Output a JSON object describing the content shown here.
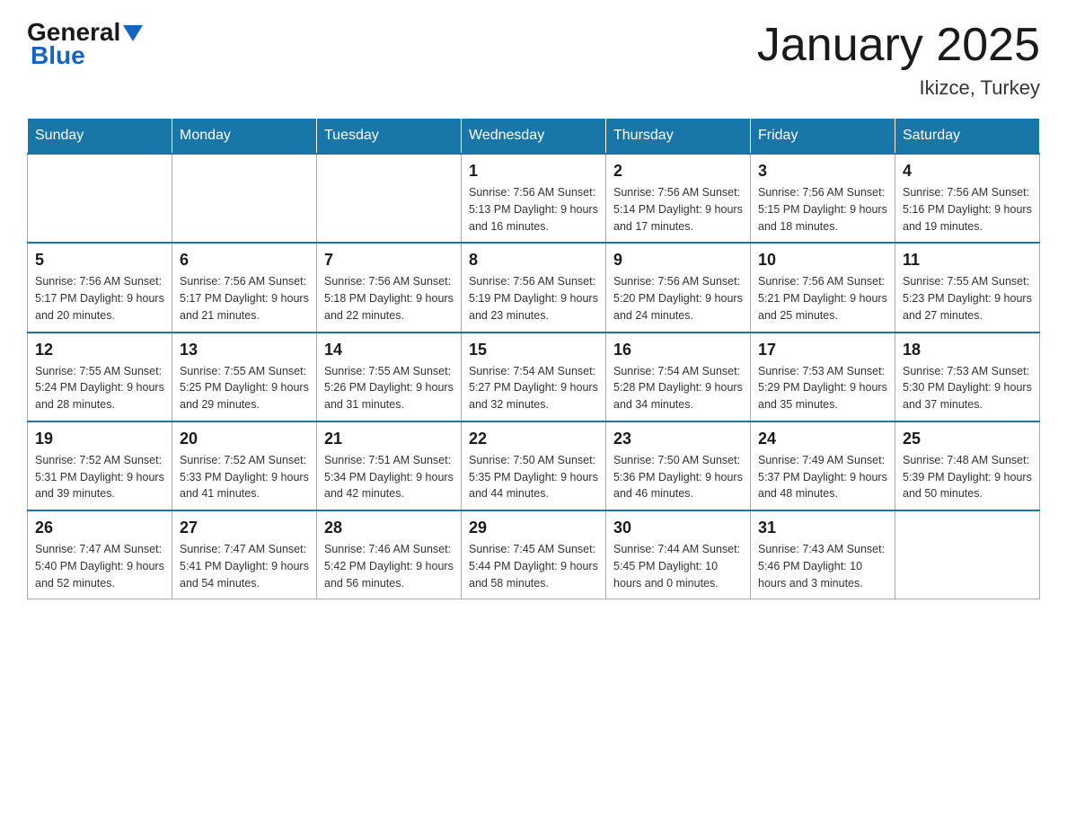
{
  "header": {
    "logo_general": "General",
    "logo_blue": "Blue",
    "title": "January 2025",
    "subtitle": "Ikizce, Turkey"
  },
  "days_of_week": [
    "Sunday",
    "Monday",
    "Tuesday",
    "Wednesday",
    "Thursday",
    "Friday",
    "Saturday"
  ],
  "weeks": [
    [
      {
        "day": "",
        "info": ""
      },
      {
        "day": "",
        "info": ""
      },
      {
        "day": "",
        "info": ""
      },
      {
        "day": "1",
        "info": "Sunrise: 7:56 AM\nSunset: 5:13 PM\nDaylight: 9 hours\nand 16 minutes."
      },
      {
        "day": "2",
        "info": "Sunrise: 7:56 AM\nSunset: 5:14 PM\nDaylight: 9 hours\nand 17 minutes."
      },
      {
        "day": "3",
        "info": "Sunrise: 7:56 AM\nSunset: 5:15 PM\nDaylight: 9 hours\nand 18 minutes."
      },
      {
        "day": "4",
        "info": "Sunrise: 7:56 AM\nSunset: 5:16 PM\nDaylight: 9 hours\nand 19 minutes."
      }
    ],
    [
      {
        "day": "5",
        "info": "Sunrise: 7:56 AM\nSunset: 5:17 PM\nDaylight: 9 hours\nand 20 minutes."
      },
      {
        "day": "6",
        "info": "Sunrise: 7:56 AM\nSunset: 5:17 PM\nDaylight: 9 hours\nand 21 minutes."
      },
      {
        "day": "7",
        "info": "Sunrise: 7:56 AM\nSunset: 5:18 PM\nDaylight: 9 hours\nand 22 minutes."
      },
      {
        "day": "8",
        "info": "Sunrise: 7:56 AM\nSunset: 5:19 PM\nDaylight: 9 hours\nand 23 minutes."
      },
      {
        "day": "9",
        "info": "Sunrise: 7:56 AM\nSunset: 5:20 PM\nDaylight: 9 hours\nand 24 minutes."
      },
      {
        "day": "10",
        "info": "Sunrise: 7:56 AM\nSunset: 5:21 PM\nDaylight: 9 hours\nand 25 minutes."
      },
      {
        "day": "11",
        "info": "Sunrise: 7:55 AM\nSunset: 5:23 PM\nDaylight: 9 hours\nand 27 minutes."
      }
    ],
    [
      {
        "day": "12",
        "info": "Sunrise: 7:55 AM\nSunset: 5:24 PM\nDaylight: 9 hours\nand 28 minutes."
      },
      {
        "day": "13",
        "info": "Sunrise: 7:55 AM\nSunset: 5:25 PM\nDaylight: 9 hours\nand 29 minutes."
      },
      {
        "day": "14",
        "info": "Sunrise: 7:55 AM\nSunset: 5:26 PM\nDaylight: 9 hours\nand 31 minutes."
      },
      {
        "day": "15",
        "info": "Sunrise: 7:54 AM\nSunset: 5:27 PM\nDaylight: 9 hours\nand 32 minutes."
      },
      {
        "day": "16",
        "info": "Sunrise: 7:54 AM\nSunset: 5:28 PM\nDaylight: 9 hours\nand 34 minutes."
      },
      {
        "day": "17",
        "info": "Sunrise: 7:53 AM\nSunset: 5:29 PM\nDaylight: 9 hours\nand 35 minutes."
      },
      {
        "day": "18",
        "info": "Sunrise: 7:53 AM\nSunset: 5:30 PM\nDaylight: 9 hours\nand 37 minutes."
      }
    ],
    [
      {
        "day": "19",
        "info": "Sunrise: 7:52 AM\nSunset: 5:31 PM\nDaylight: 9 hours\nand 39 minutes."
      },
      {
        "day": "20",
        "info": "Sunrise: 7:52 AM\nSunset: 5:33 PM\nDaylight: 9 hours\nand 41 minutes."
      },
      {
        "day": "21",
        "info": "Sunrise: 7:51 AM\nSunset: 5:34 PM\nDaylight: 9 hours\nand 42 minutes."
      },
      {
        "day": "22",
        "info": "Sunrise: 7:50 AM\nSunset: 5:35 PM\nDaylight: 9 hours\nand 44 minutes."
      },
      {
        "day": "23",
        "info": "Sunrise: 7:50 AM\nSunset: 5:36 PM\nDaylight: 9 hours\nand 46 minutes."
      },
      {
        "day": "24",
        "info": "Sunrise: 7:49 AM\nSunset: 5:37 PM\nDaylight: 9 hours\nand 48 minutes."
      },
      {
        "day": "25",
        "info": "Sunrise: 7:48 AM\nSunset: 5:39 PM\nDaylight: 9 hours\nand 50 minutes."
      }
    ],
    [
      {
        "day": "26",
        "info": "Sunrise: 7:47 AM\nSunset: 5:40 PM\nDaylight: 9 hours\nand 52 minutes."
      },
      {
        "day": "27",
        "info": "Sunrise: 7:47 AM\nSunset: 5:41 PM\nDaylight: 9 hours\nand 54 minutes."
      },
      {
        "day": "28",
        "info": "Sunrise: 7:46 AM\nSunset: 5:42 PM\nDaylight: 9 hours\nand 56 minutes."
      },
      {
        "day": "29",
        "info": "Sunrise: 7:45 AM\nSunset: 5:44 PM\nDaylight: 9 hours\nand 58 minutes."
      },
      {
        "day": "30",
        "info": "Sunrise: 7:44 AM\nSunset: 5:45 PM\nDaylight: 10 hours\nand 0 minutes."
      },
      {
        "day": "31",
        "info": "Sunrise: 7:43 AM\nSunset: 5:46 PM\nDaylight: 10 hours\nand 3 minutes."
      },
      {
        "day": "",
        "info": ""
      }
    ]
  ]
}
